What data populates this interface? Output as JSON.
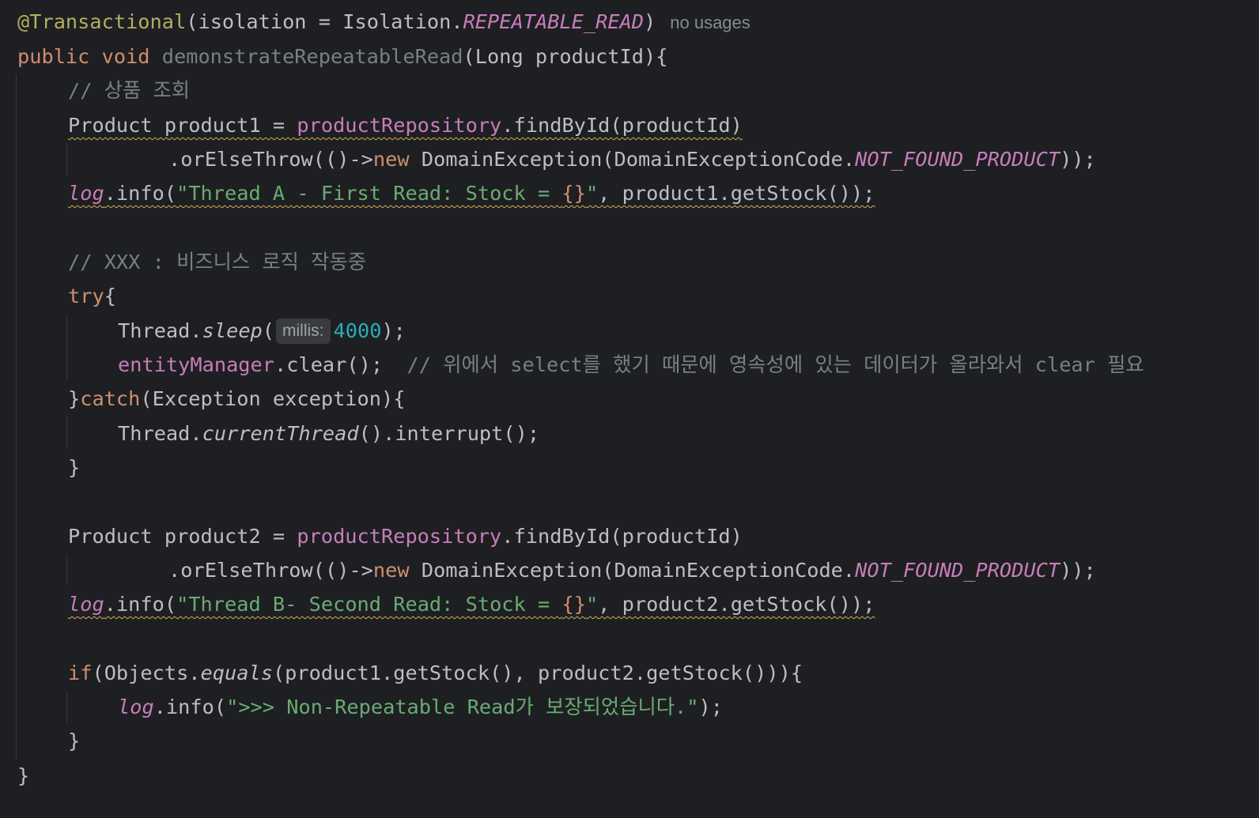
{
  "editor": {
    "annotation": {
      "name": "@Transactional",
      "arg_name": "isolation",
      "op": " = ",
      "enum_class": "Isolation.",
      "enum_value": "REPEATABLE_READ",
      "usages_hint": "no usages"
    },
    "signature": {
      "modifiers": "public void ",
      "method_name": "demonstrateRepeatableRead",
      "params": "(Long productId){"
    },
    "comment1": "// 상품 조회",
    "product1": {
      "decl": "Product product1 = ",
      "repo": "productRepository",
      "call": ".findById(productId)"
    },
    "orelse1": {
      "call": ".orElseThrow(()->",
      "kw_new": "new",
      "ctor": " DomainException(DomainExceptionCode.",
      "constant": "NOT_FOUND_PRODUCT",
      "end": "));"
    },
    "log1": {
      "logger": "log",
      "call": ".info(",
      "str_a": "\"Thread A - First Read: Stock = ",
      "placeholder": "{}",
      "str_b": "\"",
      "rest": ", product1.getStock());"
    },
    "comment2": "// XXX : 비즈니스 로직 작동중",
    "try_kw": "try",
    "try_brace": "{",
    "sleep": {
      "cls": "Thread.",
      "method": "sleep",
      "open": "(",
      "param_hint": "millis:",
      "value": "4000",
      "end": ");"
    },
    "clear": {
      "field": "entityManager",
      "call": ".clear();",
      "comment": "// 위에서 select를 했기 때문에 영속성에 있는 데이터가 올라와서 clear 필요"
    },
    "catch": {
      "close": "}",
      "kw": "catch",
      "rest": "(Exception exception){"
    },
    "interrupt": {
      "cls": "Thread.",
      "method": "currentThread",
      "rest": "().interrupt();"
    },
    "close_brace": "}",
    "product2": {
      "decl": "Product product2 = ",
      "repo": "productRepository",
      "call": ".findById(productId)"
    },
    "orelse2": {
      "call": ".orElseThrow(()->",
      "kw_new": "new",
      "ctor": " DomainException(DomainExceptionCode.",
      "constant": "NOT_FOUND_PRODUCT",
      "end": "));"
    },
    "log2": {
      "logger": "log",
      "call": ".info(",
      "str_a": "\"Thread B- Second Read: Stock = ",
      "placeholder": "{}",
      "str_b": "\"",
      "rest": ", product2.getStock());"
    },
    "if": {
      "kw": "if",
      "open": "(Objects.",
      "method": "equals",
      "rest": "(product1.getStock(), product2.getStock())){"
    },
    "log3": {
      "logger": "log",
      "call": ".info(",
      "str": "\">>> Non-Repeatable Read가 보장되었습니다.\"",
      "end": ");"
    }
  }
}
